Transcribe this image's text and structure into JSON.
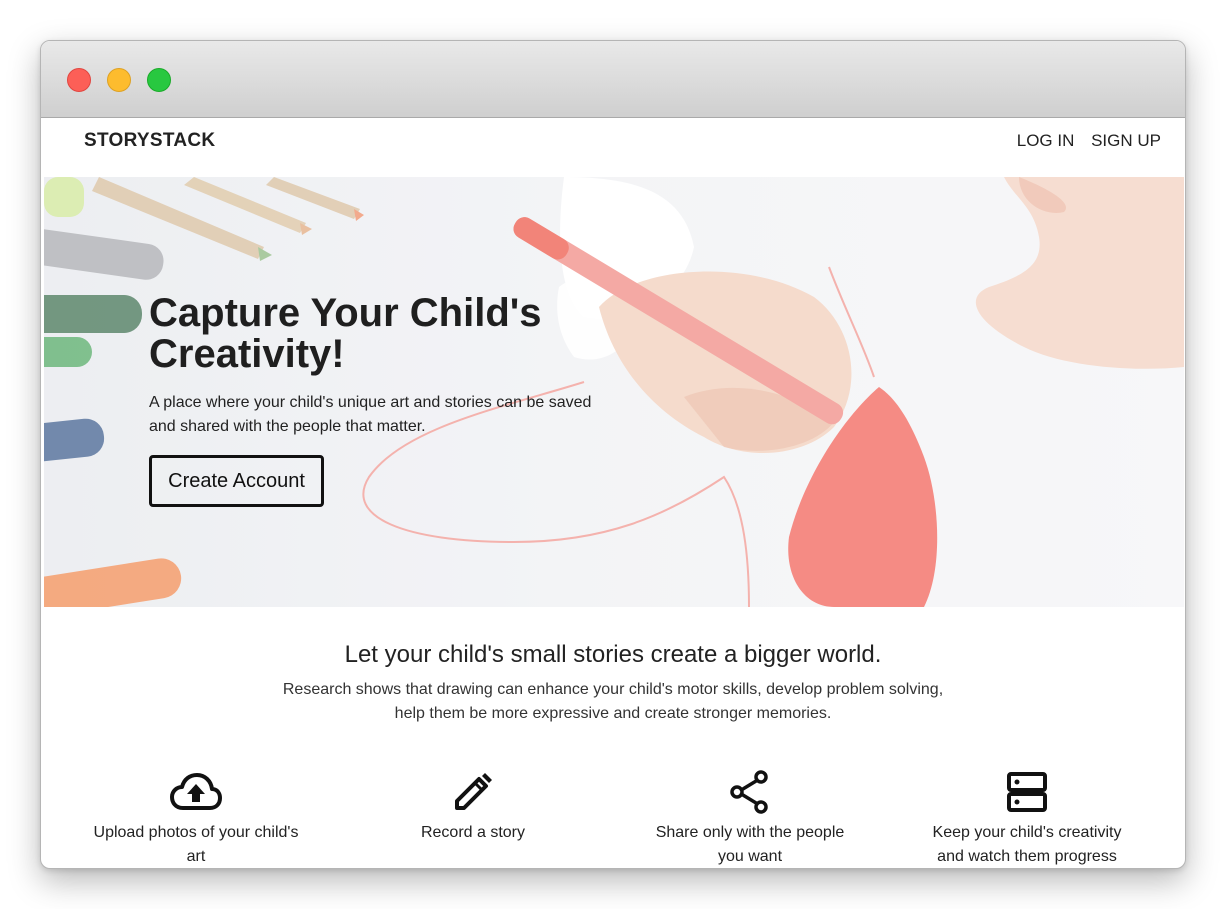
{
  "window": {
    "controls": [
      "close",
      "minimize",
      "maximize"
    ]
  },
  "nav": {
    "brand": "STORYSTACK",
    "login": "LOG IN",
    "signup": "SIGN UP"
  },
  "hero": {
    "title": "Capture Your Child's Creativity!",
    "subtitle": "A place where your child's unique art and stories can be saved and shared with the people that matter.",
    "cta": "Create Account"
  },
  "intro": {
    "title": "Let your child's small stories create a bigger world.",
    "text": "Research shows that drawing can enhance your child's motor skills, develop problem solving, help them be more expressive and create stronger memories."
  },
  "features": [
    {
      "icon": "cloud-upload-icon",
      "label": "Upload photos of your child's art"
    },
    {
      "icon": "pencil-icon",
      "label": "Record a story"
    },
    {
      "icon": "share-icon",
      "label": "Share only with the people you want"
    },
    {
      "icon": "storage-icon",
      "label": "Keep your child's creativity and watch them progress"
    }
  ],
  "colors": {
    "marker_red": "#f26a5f",
    "text": "#222222",
    "cta_border": "#111111"
  }
}
